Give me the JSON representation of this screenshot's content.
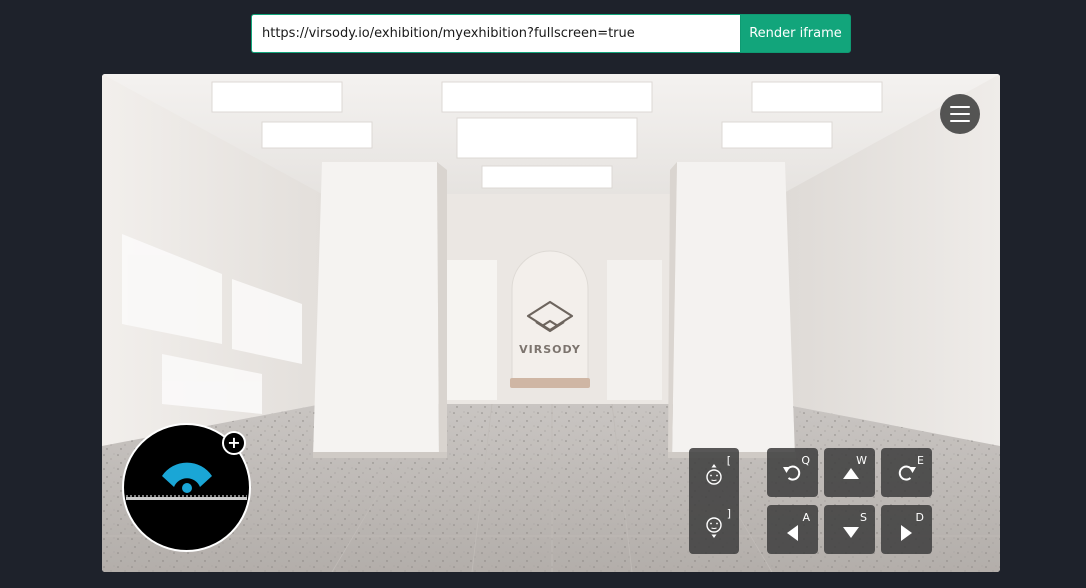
{
  "url_bar": {
    "value": "https://virsody.io/exhibition/myexhibition?fullscreen=true",
    "button_label": "Render iframe"
  },
  "scene": {
    "logo_text": "VIRSODY"
  },
  "controls": {
    "height_up_key": "[",
    "height_down_key": "]",
    "rotate_left_key": "Q",
    "forward_key": "W",
    "rotate_right_key": "E",
    "left_key": "A",
    "back_key": "S",
    "right_key": "D"
  },
  "minimap": {
    "add_label": "+"
  },
  "colors": {
    "page_bg": "#1e222b",
    "accent": "#12a57b",
    "minimap_marker": "#1aa6d6"
  }
}
